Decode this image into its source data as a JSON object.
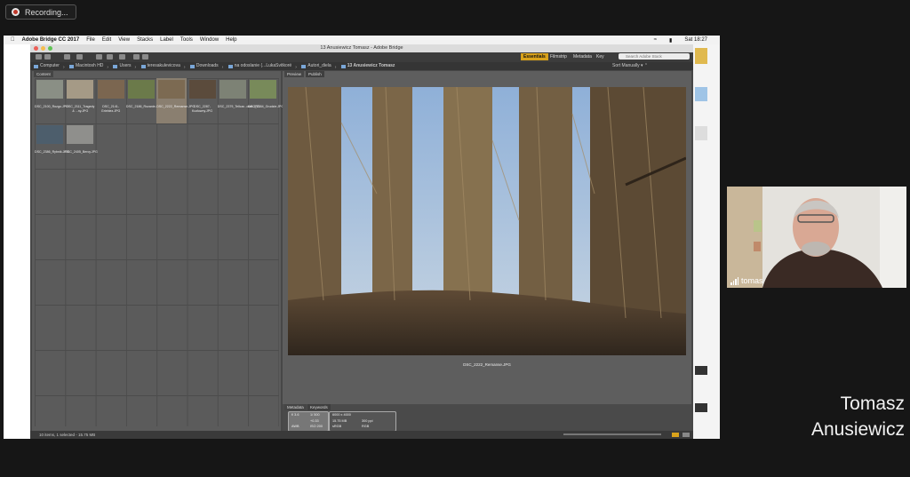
{
  "recording": {
    "label": "Recording..."
  },
  "mac_menubar": {
    "items": [
      "Adobe Bridge CC 2017",
      "File",
      "Edit",
      "View",
      "Stacks",
      "Label",
      "Tools",
      "Window",
      "Help"
    ],
    "clock": "Sat 18:27"
  },
  "window": {
    "title": "13 Anusiewicz Tomasz - Adobe Bridge",
    "workspaces": [
      "Essentials",
      "Filmstrip",
      "Metadata",
      "Key"
    ],
    "search_placeholder": "Search Adobe Stock",
    "sort_label": "Sort Manually"
  },
  "path": [
    "Computer",
    "Macintosh HD",
    "Users",
    "teresakulevicova",
    "Downloads",
    "na odoslanie (...LukaSvitkoré",
    "Autori_diela",
    "13 Anusiewicz Tomasz"
  ],
  "content_panel": {
    "tab": "Content",
    "items": [
      {
        "name": "DSC_2100_Rozgo.JPG",
        "selected": false,
        "color": "#8a8f85"
      },
      {
        "name": "DSC_2111_Tragedy & ...ny.JPG",
        "selected": false,
        "color": "#a59a86"
      },
      {
        "name": "DSC_2141-Griebiez.JPG",
        "selected": false,
        "color": "#7b6650"
      },
      {
        "name": "DSC_2186_Rozanie.JPG",
        "selected": false,
        "color": "#6b7a4a"
      },
      {
        "name": "DSC_2222_Remanse.JPG",
        "selected": true,
        "color": "#7c6a52"
      },
      {
        "name": "DSC_2287-Kozlowny.JPG",
        "selected": false,
        "color": "#5b4b3c"
      },
      {
        "name": "DSC_2379_Tellcar...own.JPG",
        "selected": false,
        "color": "#7d8275"
      },
      {
        "name": "DSC_2384_Grudzie.JPG",
        "selected": false,
        "color": "#788a5a"
      },
      {
        "name": "DSC_2386_Rybnik.JPG",
        "selected": false,
        "color": "#4d5e6c"
      },
      {
        "name": "DSC_2405_Bercy.JPG",
        "selected": false,
        "color": "#8f8f8c"
      }
    ],
    "status": "10 items, 1 selected - 15.75 MB"
  },
  "preview_panel": {
    "tabs": [
      "Preview",
      "Publish"
    ],
    "filename": "DSC_2222_Remanse.JPG"
  },
  "metadata_panel": {
    "tabs": [
      "Metadata",
      "Keywords"
    ],
    "aperture": "f/ 3.6",
    "shutter": "1/ 500",
    "ev": "+0.33",
    "iso": "ISO 200",
    "awb": "AWB",
    "dimensions": "6000 x 4000",
    "file_size": "15.75 MB",
    "resolution": "300 ppi",
    "color_space": "sRGB",
    "color_mode": "RGB"
  },
  "participant": {
    "name": "tomas",
    "display_name_line1": "Tomasz",
    "display_name_line2": "Anusiewicz"
  }
}
